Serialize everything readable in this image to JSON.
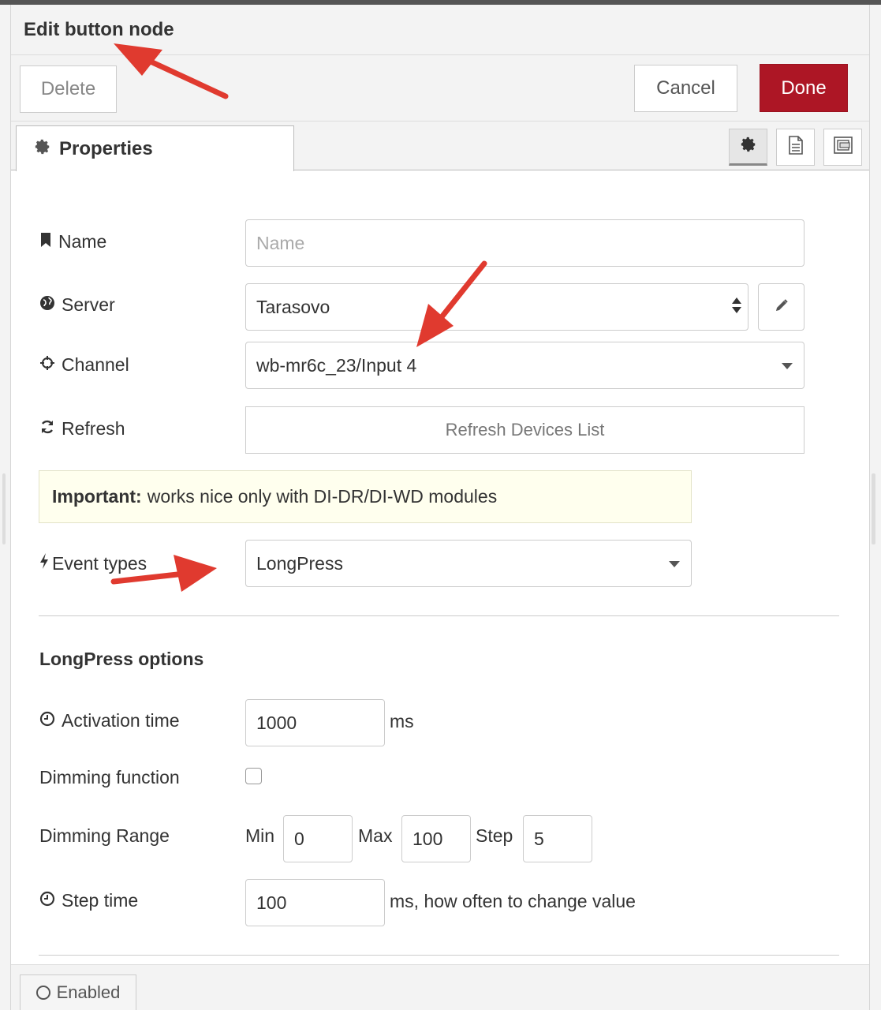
{
  "dialog": {
    "title": "Edit button node"
  },
  "toolbar": {
    "delete_label": "Delete",
    "cancel_label": "Cancel",
    "done_label": "Done"
  },
  "tabs": {
    "properties_label": "Properties",
    "properties_icon": "gear-icon",
    "side_icons": [
      "gear-icon",
      "document-icon",
      "frame-icon"
    ]
  },
  "form": {
    "name": {
      "label": "Name",
      "placeholder": "Name",
      "value": ""
    },
    "server": {
      "label": "Server",
      "value": "Tarasovo"
    },
    "channel": {
      "label": "Channel",
      "value": "wb-mr6c_23/Input 4"
    },
    "refresh": {
      "label": "Refresh",
      "button_label": "Refresh Devices List"
    },
    "notice": {
      "bold": "Important:",
      "text": "works nice only with DI-DR/DI-WD modules"
    },
    "event_types": {
      "label": "Event types",
      "value": "LongPress"
    }
  },
  "longpress": {
    "heading": "LongPress options",
    "activation_time": {
      "label": "Activation time",
      "value": "1000",
      "unit": "ms"
    },
    "dimming_function": {
      "label": "Dimming function",
      "checked": false
    },
    "dimming_range": {
      "label": "Dimming Range",
      "min_label": "Min",
      "min_value": "0",
      "max_label": "Max",
      "max_value": "100",
      "step_label": "Step",
      "step_value": "5"
    },
    "step_time": {
      "label": "Step time",
      "value": "100",
      "unit": "ms, how often to change value"
    }
  },
  "footer": {
    "enabled_label": "Enabled"
  },
  "colors": {
    "done": "#ad1625",
    "annotation_arrow": "#e03a2f",
    "notice_bg": "#ffffee"
  }
}
